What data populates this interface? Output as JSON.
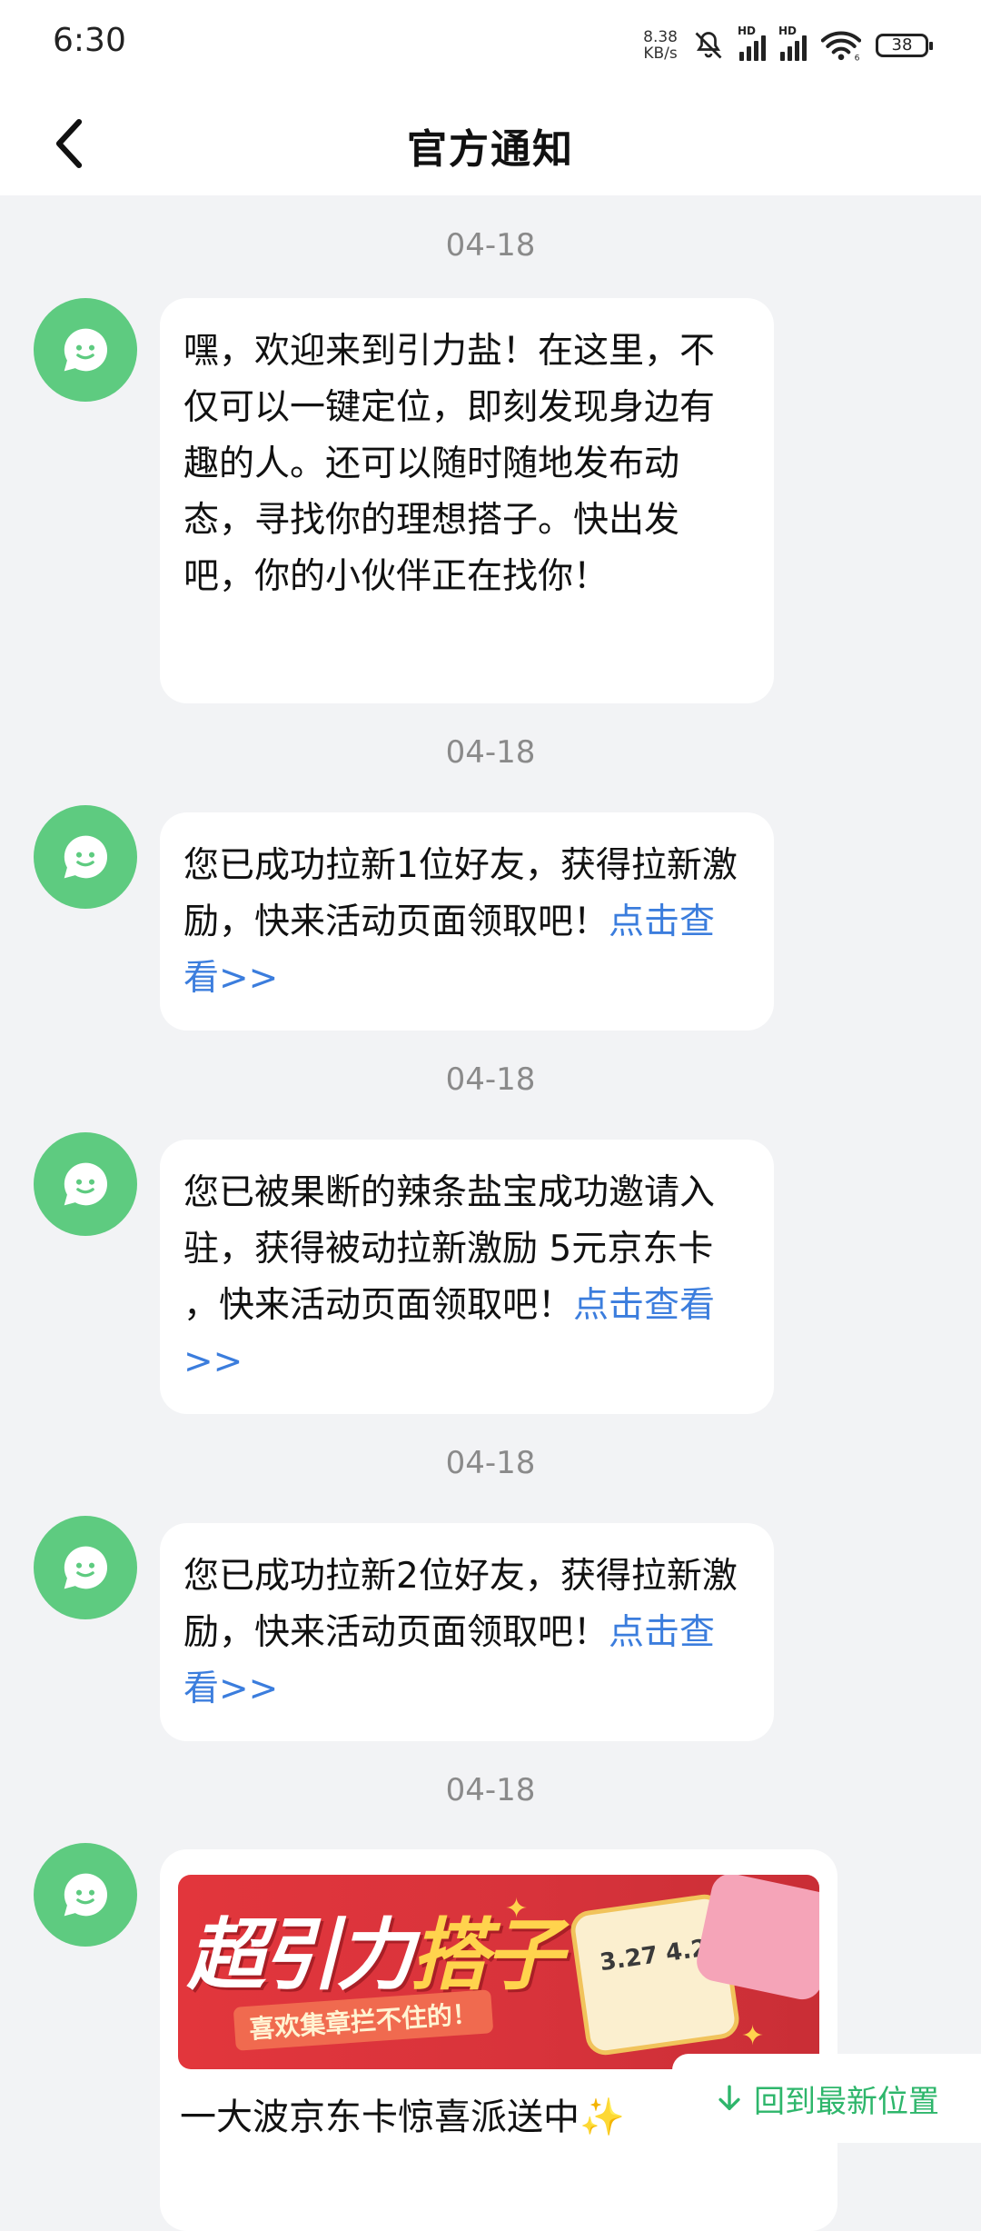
{
  "status_bar": {
    "time": "6:30",
    "net_speed_value": "8.38",
    "net_speed_unit": "KB/s",
    "sim1_label": "HD",
    "sim2_label": "HD",
    "wifi_sub": "6",
    "battery": "38"
  },
  "nav": {
    "back_icon": "chevron-left-icon",
    "title": "官方通知"
  },
  "messages": [
    {
      "date": "04-18",
      "text": "嘿，欢迎来到引力盐！在这里，不仅可以一键定位，即刻发现身边有趣的人。还可以随时随地发布动态，寻找你的理想搭子。快出发吧，你的小伙伴正在找你！",
      "link": ""
    },
    {
      "date": "04-18",
      "text": "您已成功拉新1位好友，获得拉新激励，快来活动页面领取吧！",
      "link": "点击查看>>"
    },
    {
      "date": "04-18",
      "text": "您已被果断的辣条盐宝成功邀请入驻，获得被动拉新激励 5元京东卡 ，快来活动页面领取吧！",
      "link": "点击查看>>"
    },
    {
      "date": "04-18",
      "text": "您已成功拉新2位好友，获得拉新激励，快来活动页面领取吧！",
      "link": "点击查看>>"
    },
    {
      "date": "04-18",
      "banner_title_a": "超引力",
      "banner_title_b": "搭子",
      "banner_sub": "喜欢集章拦不住的！",
      "banner_dates": "3.27 4.25",
      "text": "一大波京东卡惊喜派送中✨"
    }
  ],
  "float_button": {
    "icon": "arrow-down-icon",
    "label": "回到最新位置"
  },
  "colors": {
    "background": "#f2f3f5",
    "avatar_green": "#5ecb80",
    "link_blue": "#3b7ddd",
    "jump_green": "#2eb66b"
  }
}
